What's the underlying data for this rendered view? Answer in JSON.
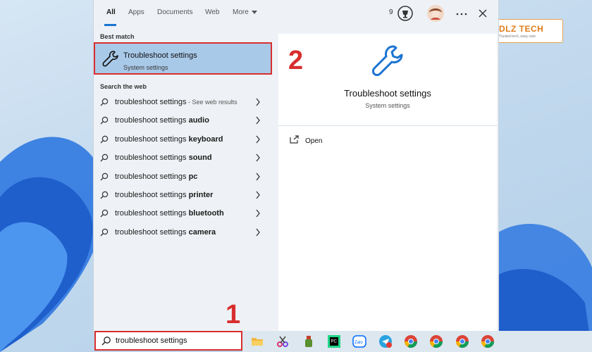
{
  "tabs": [
    {
      "label": "All"
    },
    {
      "label": "Apps"
    },
    {
      "label": "Documents"
    },
    {
      "label": "Web"
    },
    {
      "label": "More"
    }
  ],
  "header": {
    "rewards_count": "9",
    "more_options_icon": "ellipsis-icon",
    "close_icon": "close-icon"
  },
  "best_match": {
    "section_label": "Best match",
    "title": "Troubleshoot settings",
    "subtitle": "System settings",
    "icon": "wrench-icon"
  },
  "search_web": {
    "section_label": "Search the web",
    "items": [
      {
        "prefix": "troubleshoot settings",
        "bold": "",
        "suffix": " - See web results"
      },
      {
        "prefix": "troubleshoot settings ",
        "bold": "audio",
        "suffix": ""
      },
      {
        "prefix": "troubleshoot settings ",
        "bold": "keyboard",
        "suffix": ""
      },
      {
        "prefix": "troubleshoot settings ",
        "bold": "sound",
        "suffix": ""
      },
      {
        "prefix": "troubleshoot settings ",
        "bold": "pc",
        "suffix": ""
      },
      {
        "prefix": "troubleshoot settings ",
        "bold": "printer",
        "suffix": ""
      },
      {
        "prefix": "troubleshoot settings ",
        "bold": "bluetooth",
        "suffix": ""
      },
      {
        "prefix": "troubleshoot settings ",
        "bold": "camera",
        "suffix": ""
      }
    ]
  },
  "preview": {
    "title": "Troubleshoot settings",
    "subtitle": "System settings",
    "open_label": "Open"
  },
  "search": {
    "value": "troubleshoot settings"
  },
  "markers": {
    "step1": "1",
    "step2": "2"
  },
  "logo": {
    "brand": "DLZ TECH",
    "tagline": "Trusted tech, easy care"
  },
  "taskbar": {
    "icons": [
      "file-explorer-icon",
      "snipping-tool-icon",
      "cleaner-icon",
      "pycharm-icon",
      "zalo-icon",
      "telegram-icon",
      "chrome-icon",
      "chrome-icon",
      "chrome-icon",
      "chrome-icon"
    ],
    "telegram_badge": "31"
  },
  "colors": {
    "accent": "#1a73d1",
    "highlight": "#a9c9e8",
    "annotation": "#d82e2e"
  }
}
